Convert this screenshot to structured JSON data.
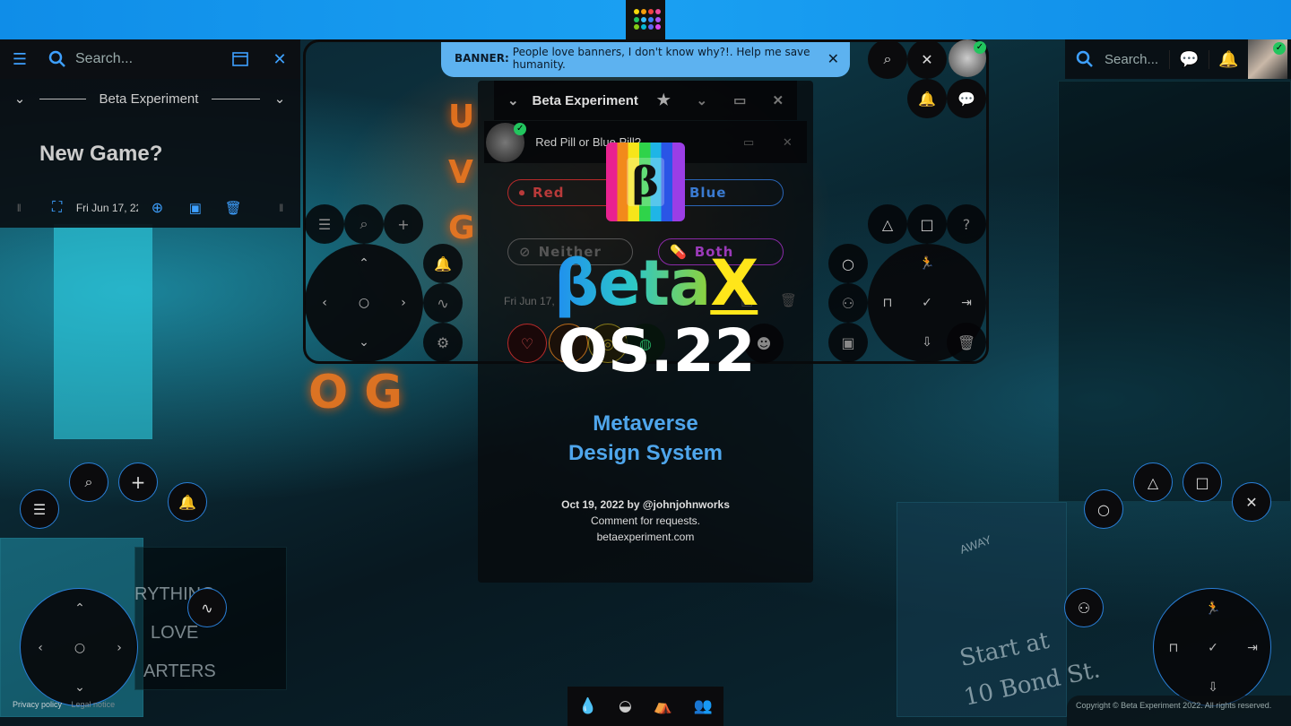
{
  "banner": {
    "label": "BANNER:",
    "text": "People love banners, I don't know why?!. Help me save humanity."
  },
  "left_panel": {
    "search_placeholder": "Search...",
    "section_title": "Beta Experiment",
    "heading": "New Game?",
    "date": "Fri Jun 17, 22"
  },
  "right_bar": {
    "search_placeholder": "Search..."
  },
  "center_window": {
    "title": "Beta Experiment",
    "subtitle": "Red Pill or Blue Pill?",
    "pills": {
      "red": "Red",
      "blue": "Blue",
      "neither": "Neither",
      "both": "Both"
    },
    "date": "Fri Jun 17,"
  },
  "hero": {
    "badge": "β",
    "brand_main": "βeta",
    "brand_x": "X",
    "version": "OS.22",
    "tagline_1": "Metaverse",
    "tagline_2": "Design System",
    "byline": "Oct 19, 2022 by @johnjohnworks",
    "note": "Comment for requests.",
    "site": "betaexperiment.com"
  },
  "background_signs": {
    "sign_1": "RYTHING",
    "sign_2": "LOVE",
    "sign_3": "ARTERS",
    "sign_4": "Start at",
    "sign_5": "10 Bond St.",
    "sign_6": "AWAY"
  },
  "footer": {
    "privacy": "Privacy policy",
    "legal": "Legal notice",
    "copyright": "Copyright © Beta Experiment 2022. All rights reserved."
  },
  "colors": {
    "accent": "#1aa0f2",
    "banner": "#5db2f0",
    "brand_yellow": "#ffe61a",
    "tagline": "#4fa6ec",
    "status_ok": "#22c55e"
  },
  "icons": [
    "menu-icon",
    "search-icon",
    "window-icon",
    "close-icon",
    "chevron-down-icon",
    "star-icon",
    "bell-icon",
    "chat-icon",
    "plus-icon",
    "trash-icon",
    "save-icon",
    "triangle-icon",
    "square-icon",
    "circle-icon",
    "question-icon",
    "heart-icon",
    "fingerprint-icon",
    "wave-icon",
    "gear-icon",
    "drop-icon",
    "people-icon",
    "camp-icon",
    "bowl-icon"
  ]
}
